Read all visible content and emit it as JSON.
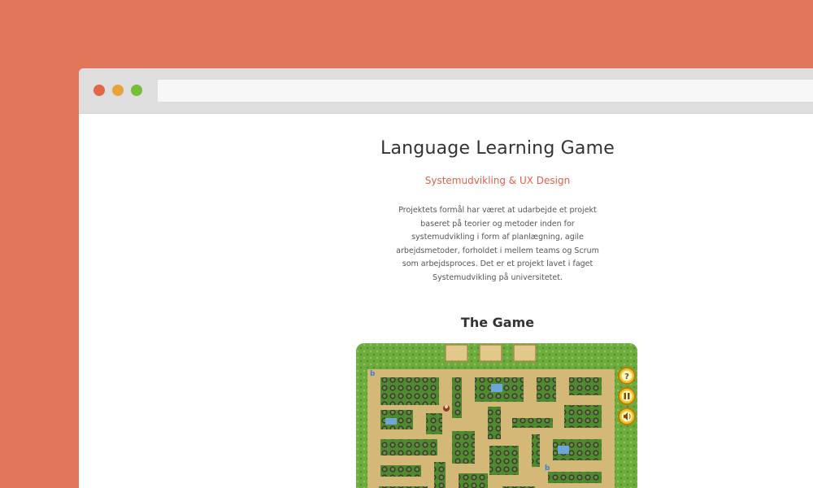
{
  "page": {
    "title": "Language Learning Game",
    "subtitle": "Systemudvikling & UX Design",
    "description": "Projektets formål har været at udarbejde et projekt baseret på teorier og metoder inden for systemudvikling i form af planlægning, agile arbejdsmetoder, forholdet i mellem teams og Scrum som arbejdsproces. Det er et projekt lavet i faget Systemudvikling på universitetet.",
    "game_heading": "The Game"
  },
  "browser": {
    "address_value": ""
  },
  "game": {
    "controls": [
      {
        "name": "help-icon",
        "glyph": "?"
      },
      {
        "name": "pause-icon",
        "glyph": "II"
      },
      {
        "name": "sound-icon",
        "glyph": "🔊"
      }
    ]
  },
  "colors": {
    "background": "#e2765a",
    "accent": "#e2604a",
    "grass": "#6cab3c",
    "path": "#d4b877"
  }
}
